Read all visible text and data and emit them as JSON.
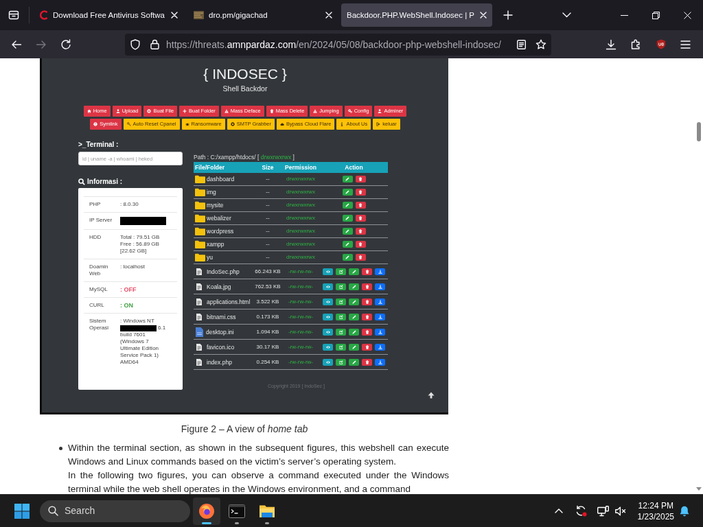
{
  "browser": {
    "tabs": [
      {
        "title": "Download Free Antivirus Softwa",
        "selected": false
      },
      {
        "title": "dro.pm/gigachad",
        "selected": false
      },
      {
        "title": "Backdoor.PHP.WebShell.Indosec | P",
        "selected": true
      }
    ],
    "back": {
      "disabled": false
    },
    "forward": {
      "disabled": true
    },
    "url": {
      "scheme_host": "https://threats.",
      "domain": "amnpardaz.com",
      "path": "/en/2024/05/08/backdoor-php-webshell-indosec/"
    }
  },
  "shell": {
    "title": "{ INDOSEC }",
    "subtitle": "Shell Backdor",
    "menu_rows": [
      [
        {
          "label": "Home",
          "color": "#dc3545"
        },
        {
          "label": "Upload",
          "color": "#dc3545"
        },
        {
          "label": "Buat File",
          "color": "#dc3545"
        },
        {
          "label": "Buat Folder",
          "color": "#dc3545"
        },
        {
          "label": "Mass Deface",
          "color": "#dc3545"
        },
        {
          "label": "Mass Delete",
          "color": "#dc3545"
        },
        {
          "label": "Jumping",
          "color": "#dc3545"
        },
        {
          "label": "Config",
          "color": "#dc3545"
        },
        {
          "label": "Adminer",
          "color": "#dc3545"
        }
      ],
      [
        {
          "label": "Symlink",
          "color": "#dc3545"
        },
        {
          "label": "Auto Reset Cpanel",
          "color": "#ffc107"
        },
        {
          "label": "Ransomware",
          "color": "#ffc107"
        },
        {
          "label": "SMTP Grabber",
          "color": "#ffc107"
        },
        {
          "label": "Bypass Cloud Flare",
          "color": "#ffc107"
        },
        {
          "label": "About Us",
          "color": "#ffc107"
        },
        {
          "label": "keluar",
          "color": "#ffc107"
        }
      ]
    ],
    "terminal": {
      "label": ">_Terminal :",
      "placeholder": "id | uname -a | whoami | heked"
    },
    "info": {
      "label": "Informasi :",
      "rows": [
        {
          "label": "PHP",
          "value": [
            {
              "kind": "text",
              "text": ": 8.0.30"
            }
          ]
        },
        {
          "label": "IP Server",
          "value": [
            {
              "kind": "redacted"
            }
          ]
        },
        {
          "label": "HDD",
          "value": [
            {
              "kind": "text",
              "text": "Total : 79.51 GB"
            },
            {
              "kind": "text",
              "text": "Free : 56.89 GB"
            },
            {
              "kind": "text",
              "text": "[22.62 GB]"
            }
          ]
        },
        {
          "label": "Doamin Web",
          "value": [
            {
              "kind": "text",
              "text": ": localhost"
            }
          ]
        },
        {
          "label": "MySQL",
          "value": [
            {
              "kind": "text",
              "text": ": OFF",
              "color": "#e8506a"
            }
          ]
        },
        {
          "label": "CURL",
          "value": [
            {
              "kind": "text",
              "text": ": ON",
              "color": "#43a047"
            }
          ]
        },
        {
          "label": "Sistem Operasi",
          "value": [
            {
              "kind": "text",
              "text": ": Windows NT"
            },
            {
              "kind": "redacted"
            },
            {
              "kind": "text",
              "text": "6.1"
            },
            {
              "kind": "text",
              "text": "build 7601 (Windows 7 Ultimate Edition Service Pack 1) AMD64"
            }
          ]
        }
      ]
    },
    "path": {
      "prefix": "Path : C:/xampp/htdocs/ [",
      "permission": "drwxrwxrwx",
      "suffix": "]"
    },
    "table": {
      "columns": [
        "File/Folder",
        "Size",
        "Permission",
        "Action"
      ],
      "rows": [
        {
          "kind": "folder",
          "name": "dashboard",
          "size": "--",
          "permission": "drwxrwxrwx"
        },
        {
          "kind": "folder",
          "name": "img",
          "size": "--",
          "permission": "drwxrwxrwx"
        },
        {
          "kind": "folder",
          "name": "mysite",
          "size": "--",
          "permission": "drwxrwxrwx"
        },
        {
          "kind": "folder",
          "name": "webalizer",
          "size": "--",
          "permission": "drwxrwxrwx"
        },
        {
          "kind": "folder",
          "name": "wordpress",
          "size": "--",
          "permission": "drwxrwxrwx"
        },
        {
          "kind": "folder",
          "name": "xampp",
          "size": "--",
          "permission": "drwxrwxrwx"
        },
        {
          "kind": "folder",
          "name": "yu",
          "size": "--",
          "permission": "drwxrwxrwx"
        },
        {
          "kind": "file",
          "name": "IndoSec.php",
          "size": "66.243 KB",
          "permission": "-rw-rw-rw-"
        },
        {
          "kind": "file",
          "name": "Koala.jpg",
          "size": "762.53 KB",
          "permission": "-rw-rw-rw-"
        },
        {
          "kind": "file",
          "name": "applications.html",
          "size": "3.522 KB",
          "permission": "-rw-rw-rw-"
        },
        {
          "kind": "file",
          "name": "bitnami.css",
          "size": "0.173 KB",
          "permission": "-rw-rw-rw-"
        },
        {
          "kind": "config",
          "name": "desktop.ini",
          "size": "1.094 KB",
          "permission": "-rw-rw-rw-"
        },
        {
          "kind": "file",
          "name": "favicon.ico",
          "size": "30.17 KB",
          "permission": "-rw-rw-rw-"
        },
        {
          "kind": "file",
          "name": "index.php",
          "size": "0.254 KB",
          "permission": "-rw-rw-rw-"
        }
      ]
    },
    "footer": "Copyright 2019 [ IndoSec ]"
  },
  "caption": "Figure 2 – A view of *home tab*",
  "bullets": [
    {
      "paragraphs": [
        "Within the terminal section, as shown in the subsequent figures, this webshell can execute Windows and Linux commands based on the victim’s server’s operating system.",
        "In the following two figures, you can observe a command executed under the Windows terminal while the web shell operates in the Windows environment, and a command"
      ]
    }
  ],
  "taskbar": {
    "search": {
      "placeholder": "Search"
    },
    "apps": [
      {
        "selected": true
      },
      {
        "selected": false
      },
      {
        "selected": false
      }
    ],
    "clock": {
      "time": "12:24 PM",
      "date": "1/23/2025"
    }
  }
}
